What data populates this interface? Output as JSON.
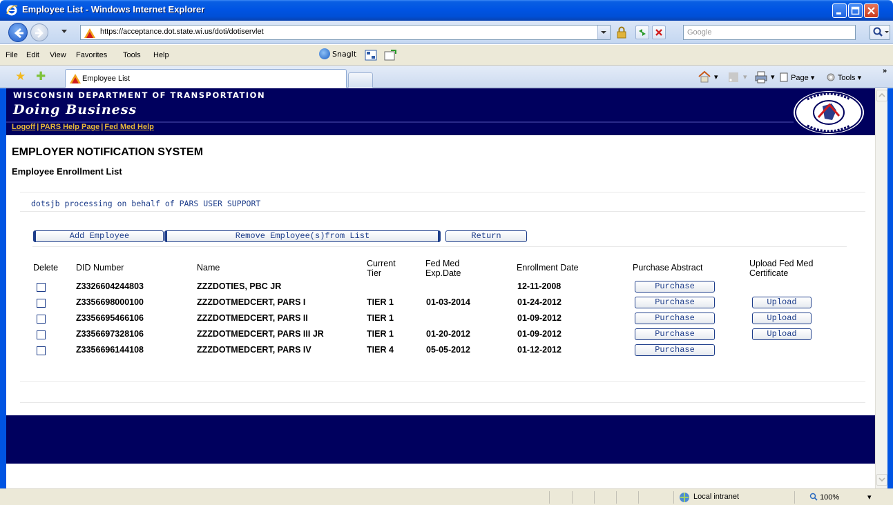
{
  "window": {
    "title": "Employee List - Windows Internet Explorer"
  },
  "address": {
    "url": "https://acceptance.dot.state.wi.us/doti/dotiservlet",
    "search_placeholder": "Google"
  },
  "menu": {
    "items": [
      "File",
      "Edit",
      "View",
      "Favorites",
      "Tools",
      "Help"
    ],
    "snagit": "SnagIt"
  },
  "tabs": {
    "active_label": "Employee List",
    "page_label": "Page",
    "tools_label": "Tools"
  },
  "banner": {
    "dept": "WISCONSIN DEPARTMENT OF TRANSPORTATION",
    "doing_business": "Doing Business",
    "links": [
      "Logoff",
      "PARS Help Page",
      "Fed Med Help"
    ]
  },
  "page": {
    "heading": "EMPLOYER NOTIFICATION SYSTEM",
    "subheading": "Employee Enrollment List",
    "processing": "dotsjb processing on behalf of PARS USER SUPPORT"
  },
  "actions": {
    "add": "Add Employee",
    "remove": "Remove Employee(s)from List",
    "return": "Return"
  },
  "table": {
    "headers": {
      "delete": "Delete",
      "did": "DID Number",
      "name": "Name",
      "tier": "Current Tier",
      "fedmed": "Fed Med Exp.Date",
      "enroll": "Enrollment Date",
      "purchase": "Purchase Abstract",
      "upload": "Upload Fed Med Certificate"
    },
    "purchase_label": "Purchase",
    "upload_label": "Upload",
    "rows": [
      {
        "did": "Z3326604244803",
        "name": "ZZZDOTIES, PBC JR",
        "tier": "",
        "fedmed": "",
        "enroll": "12-11-2008",
        "upload": false
      },
      {
        "did": "Z3356698000100",
        "name": "ZZZDOTMEDCERT, PARS I",
        "tier": "TIER 1",
        "fedmed": "01-03-2014",
        "enroll": "01-24-2012",
        "upload": true
      },
      {
        "did": "Z3356695466106",
        "name": "ZZZDOTMEDCERT, PARS II",
        "tier": "TIER 1",
        "fedmed": "",
        "enroll": "01-09-2012",
        "upload": true
      },
      {
        "did": "Z3356697328106",
        "name": "ZZZDOTMEDCERT, PARS III JR",
        "tier": "TIER 1",
        "fedmed": "01-20-2012",
        "enroll": "01-09-2012",
        "upload": true
      },
      {
        "did": "Z3356696144108",
        "name": "ZZZDOTMEDCERT, PARS IV",
        "tier": "TIER 4",
        "fedmed": "05-05-2012",
        "enroll": "01-12-2012",
        "upload": false
      }
    ]
  },
  "status": {
    "zone": "Local intranet",
    "zoom": "100%"
  },
  "colors": {
    "banner": "#00005e",
    "link": "#e8b83a",
    "button_text": "#1d3d8a"
  }
}
